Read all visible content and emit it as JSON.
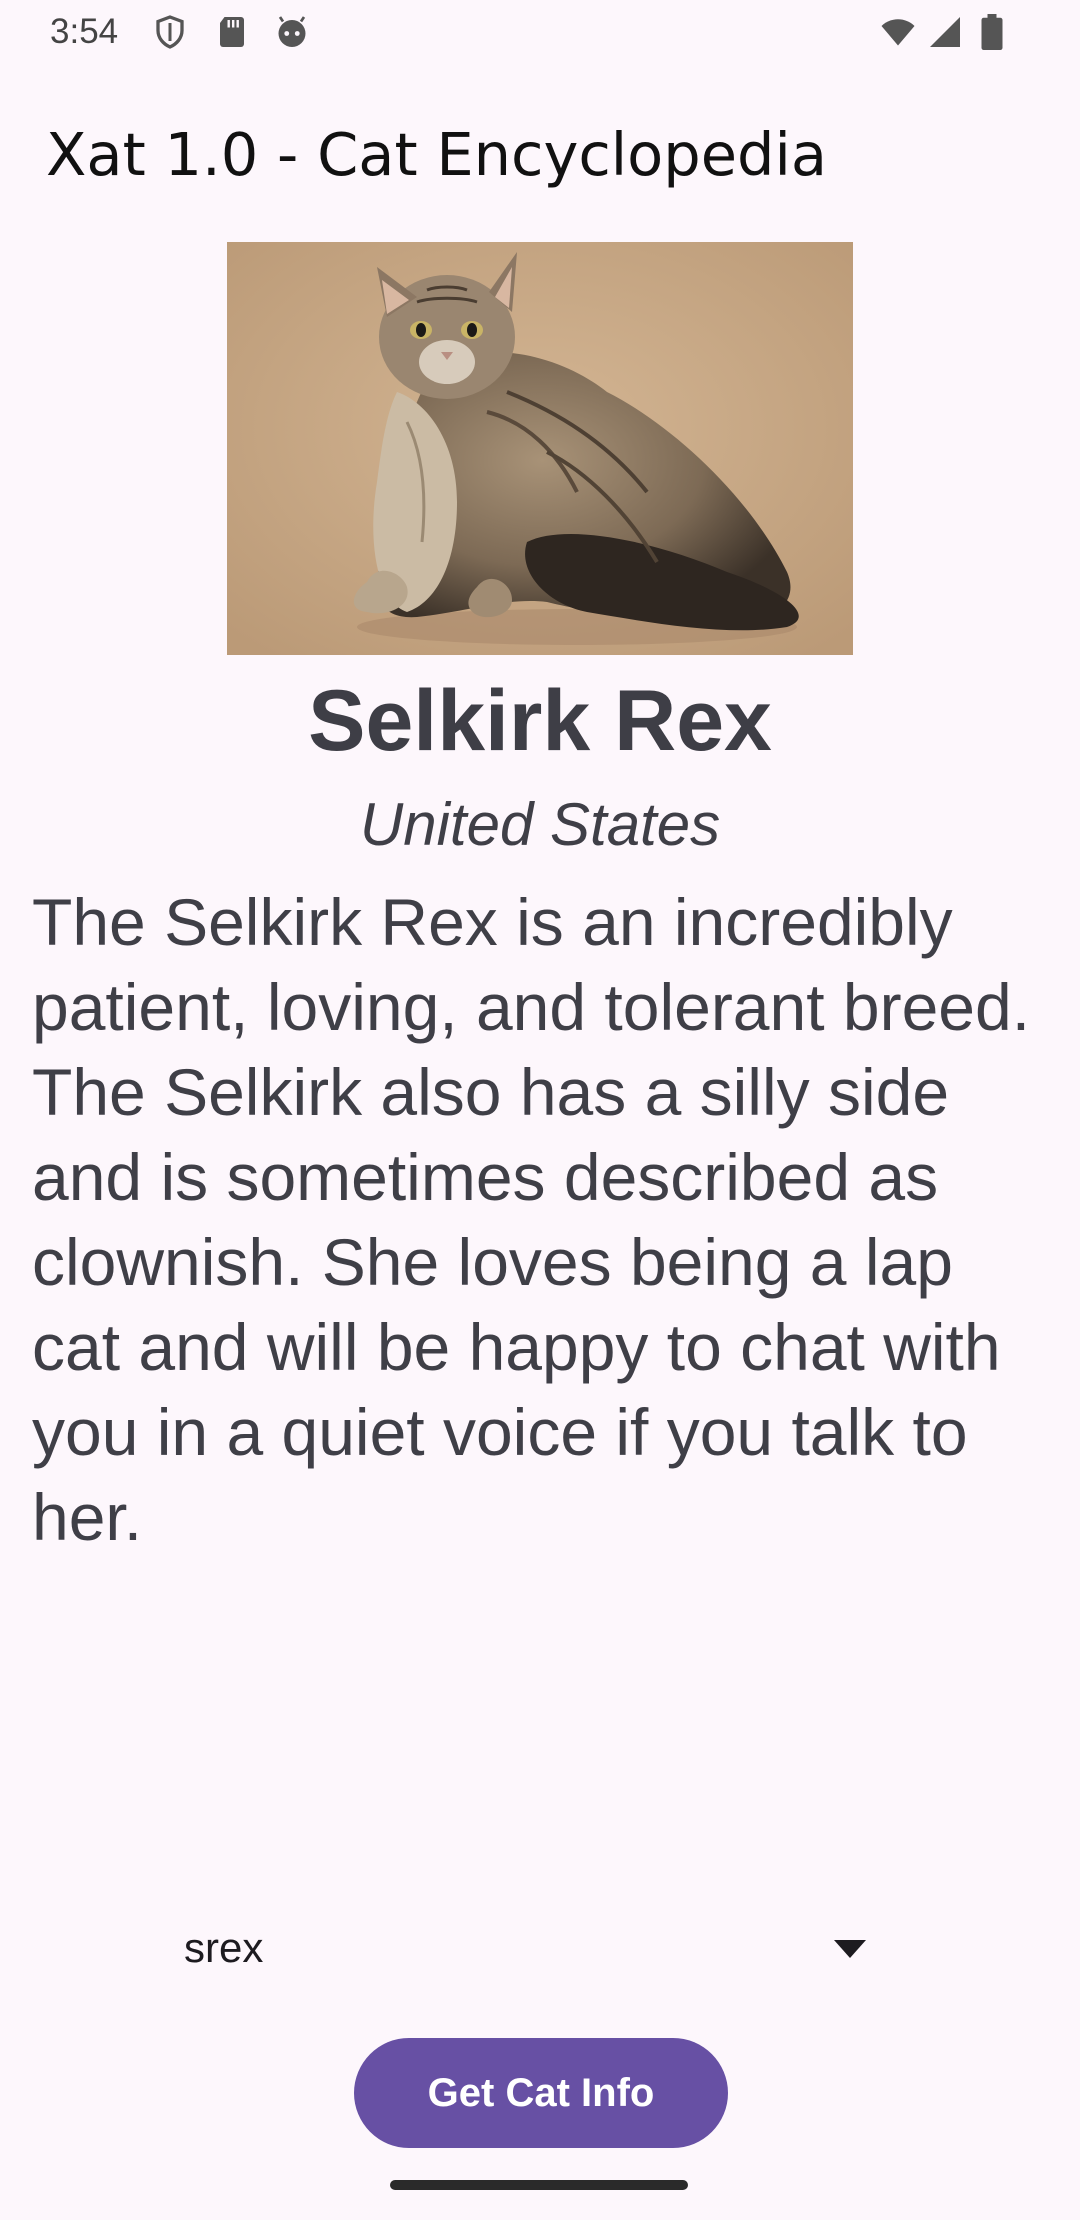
{
  "status_bar": {
    "time": "3:54",
    "left_icons": [
      "shield-icon",
      "sd-card-icon",
      "android-face-icon"
    ],
    "right_icons": [
      "wifi-icon",
      "signal-icon",
      "battery-icon"
    ]
  },
  "app_bar": {
    "title": "Xat 1.0 - Cat Encyclopedia"
  },
  "breed": {
    "image_icon": "cat-photo",
    "name": "Selkirk Rex",
    "origin": "United States",
    "description": "The Selkirk Rex is an incredibly patient, loving, and tolerant breed. The Selkirk also has a silly side and is sometimes described as clownish. She loves being a lap cat and will be happy to chat with you in a quiet voice if you talk to her."
  },
  "spinner": {
    "selected_value": "srex",
    "icon": "dropdown-arrow-icon"
  },
  "button": {
    "label": "Get Cat Info"
  },
  "colors": {
    "background": "#fdf7fc",
    "button": "#6750a4",
    "text_primary": "#3e3e46"
  }
}
